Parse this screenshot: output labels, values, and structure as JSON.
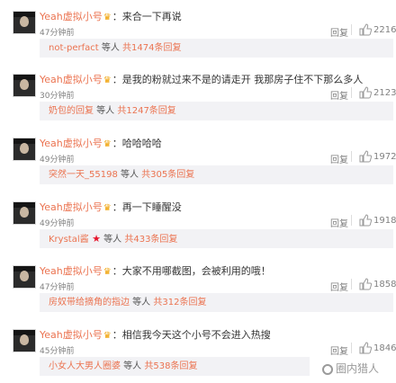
{
  "comments": [
    {
      "user": "Yeah虚拟小号",
      "vip_badge": "vip-crown-icon",
      "separator": "：",
      "text": "来合一下再说",
      "time": "47分钟前",
      "reply_label": "回复",
      "likes": "2216",
      "sub": {
        "names": "not-perfact",
        "suffix": " 等人 ",
        "total": "共1474条回复"
      }
    },
    {
      "user": "Yeah虚拟小号",
      "vip_badge": "vip-crown-icon",
      "separator": "：",
      "text": "是我的粉就过来不是的请走开 我那房子住不下那么多人",
      "time": "30分钟前",
      "reply_label": "回复",
      "likes": "2123",
      "sub": {
        "names": "奶包的回复",
        "suffix": " 等人 ",
        "total": "共1247条回复"
      }
    },
    {
      "user": "Yeah虚拟小号",
      "vip_badge": "vip-crown-icon",
      "separator": "：",
      "text": "哈哈哈哈",
      "time": "49分钟前",
      "reply_label": "回复",
      "likes": "1972",
      "sub": {
        "names": "突然一天_55198",
        "suffix": " 等人 ",
        "total": "共305条回复"
      }
    },
    {
      "user": "Yeah虚拟小号",
      "vip_badge": "vip-crown-icon",
      "separator": "：",
      "text": "再一下睡醒没",
      "time": "49分钟前",
      "reply_label": "回复",
      "likes": "1918",
      "sub": {
        "names": "Krystal酱",
        "suffix": " 等人 ",
        "total": "共433条回复",
        "has_star": true
      }
    },
    {
      "user": "Yeah虚拟小号",
      "vip_badge": "vip-crown-icon",
      "separator": "：",
      "text": "大家不用哪截图，会被利用的哦！",
      "time": "47分钟前",
      "reply_label": "回复",
      "likes": "1858",
      "sub": {
        "names": "房奴带给摘角的指边",
        "suffix": " 等人 ",
        "total": "共312条回复"
      }
    },
    {
      "user": "Yeah虚拟小号",
      "vip_badge": "vip-crown-icon",
      "separator": "：",
      "text": "相信我今天这个小号不会进入热搜",
      "time": "45分钟前",
      "reply_label": "回复",
      "likes": "1846",
      "sub": {
        "names": "小女人大男人圈婆",
        "suffix": " 等人 ",
        "total": "共538条回复"
      }
    }
  ],
  "watermark": {
    "text": "圈内猎人",
    "icon": "weibo-logo-icon"
  },
  "colors": {
    "name": "#eb7350",
    "meta": "#808080",
    "sub_bg": "#f2f2f5",
    "text": "#333333"
  }
}
